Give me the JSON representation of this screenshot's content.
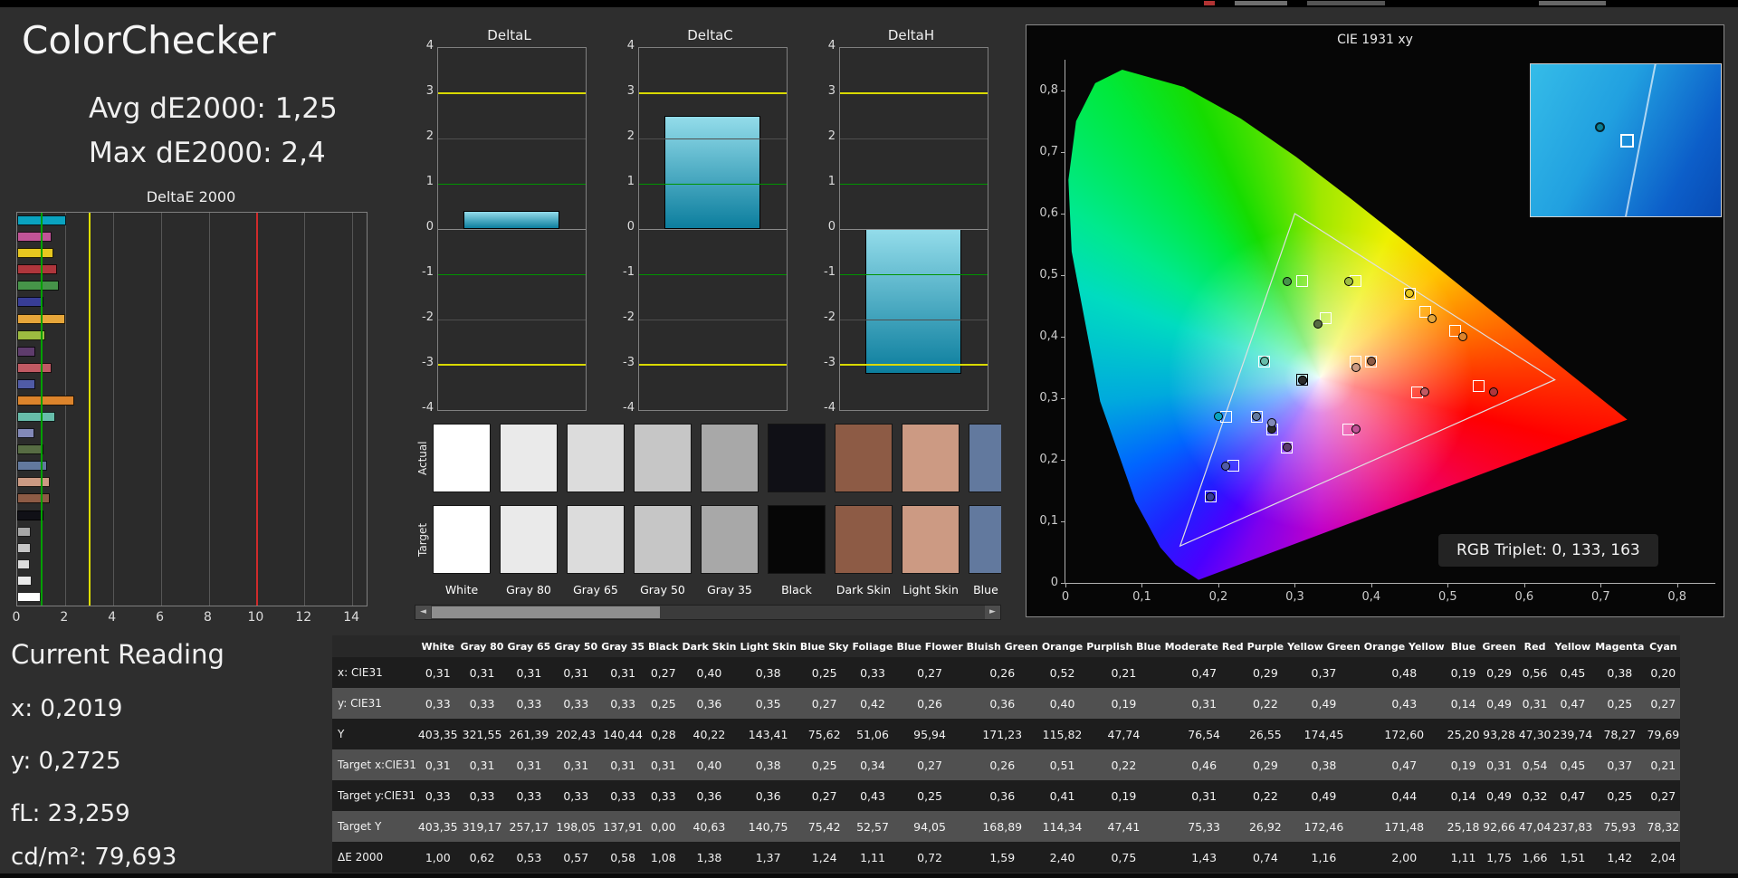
{
  "header": {
    "title": "ColorChecker",
    "avg": "Avg dE2000: 1,25",
    "max": "Max dE2000: 2,4"
  },
  "current_reading": {
    "title": "Current Reading",
    "lines": [
      "x: 0,2019",
      "y: 0,2725",
      "fL: 23,259",
      "cd/m²: 79,693"
    ]
  },
  "deltae_chart": {
    "title": "DeltaE 2000",
    "x_ticks": [
      0,
      2,
      4,
      6,
      8,
      10,
      12,
      14
    ],
    "x_max": 14.6,
    "thresholds": {
      "green": 1,
      "yellow": 3,
      "red": 10
    }
  },
  "delta_bars": {
    "y_ticks": [
      "4",
      "3",
      "2",
      "1",
      "0",
      "-1",
      "-2",
      "-3",
      "-4"
    ],
    "charts": [
      {
        "title": "DeltaL",
        "value": 0.4
      },
      {
        "title": "DeltaC",
        "value": 2.5
      },
      {
        "title": "DeltaH",
        "value": -3.2
      }
    ]
  },
  "swatch_panel": {
    "row_labels": [
      "Actual",
      "Target"
    ],
    "visible_count": 9,
    "scrollbar": {
      "left_arrow": "◄",
      "right_arrow": "►"
    }
  },
  "cie": {
    "title": "CIE 1931 xy",
    "rgb_label": "RGB Triplet: 0, 133, 163",
    "tick_labels": [
      "0",
      "0,1",
      "0,2",
      "0,3",
      "0,4",
      "0,5",
      "0,6",
      "0,7",
      "0,8"
    ],
    "axis_max": 0.85,
    "srgb_triangle": [
      [
        0.64,
        0.33
      ],
      [
        0.3,
        0.6
      ],
      [
        0.15,
        0.06
      ]
    ],
    "locus": [
      [
        0.1741,
        0.005
      ],
      [
        0.144,
        0.0297
      ],
      [
        0.1241,
        0.0578
      ],
      [
        0.0913,
        0.1327
      ],
      [
        0.0454,
        0.295
      ],
      [
        0.0082,
        0.5384
      ],
      [
        0.0039,
        0.6548
      ],
      [
        0.0139,
        0.7502
      ],
      [
        0.0389,
        0.812
      ],
      [
        0.0743,
        0.8338
      ],
      [
        0.1547,
        0.8059
      ],
      [
        0.2296,
        0.7543
      ],
      [
        0.3016,
        0.6923
      ],
      [
        0.3731,
        0.6245
      ],
      [
        0.4441,
        0.5547
      ],
      [
        0.5125,
        0.4866
      ],
      [
        0.5752,
        0.4242
      ],
      [
        0.627,
        0.3725
      ],
      [
        0.6915,
        0.3083
      ],
      [
        0.7347,
        0.2653
      ]
    ]
  },
  "table": {
    "corner": "",
    "columns": [
      "White",
      "Gray 80",
      "Gray 65",
      "Gray 50",
      "Gray 35",
      "Black",
      "Dark Skin",
      "Light Skin",
      "Blue Sky",
      "Foliage",
      "Blue Flower",
      "Bluish Green",
      "Orange",
      "Purplish Blue",
      "Moderate Red",
      "Purple",
      "Yellow Green",
      "Orange Yellow",
      "Blue",
      "Green",
      "Red",
      "Yellow",
      "Magenta",
      "Cyan"
    ],
    "rows": [
      {
        "label": "x: CIE31",
        "key": "x"
      },
      {
        "label": "y: CIE31",
        "key": "y"
      },
      {
        "label": "Y",
        "key": "Y"
      },
      {
        "label": "Target x:CIE31",
        "key": "tx"
      },
      {
        "label": "Target y:CIE31",
        "key": "ty"
      },
      {
        "label": "Target Y",
        "key": "tY"
      },
      {
        "label": "ΔE 2000",
        "key": "dE"
      }
    ]
  },
  "patches": [
    {
      "name": "White",
      "color": "#ffffff",
      "neutral": true,
      "x": "0,31",
      "y": "0,33",
      "Y": "403,35",
      "tx": "0,31",
      "ty": "0,33",
      "tY": "403,35",
      "dE": "1,00"
    },
    {
      "name": "Gray 80",
      "color": "#eaeaea",
      "neutral": true,
      "x": "0,31",
      "y": "0,33",
      "Y": "321,55",
      "tx": "0,31",
      "ty": "0,33",
      "tY": "319,17",
      "dE": "0,62"
    },
    {
      "name": "Gray 65",
      "color": "#dcdcdc",
      "neutral": true,
      "x": "0,31",
      "y": "0,33",
      "Y": "261,39",
      "tx": "0,31",
      "ty": "0,33",
      "tY": "257,17",
      "dE": "0,53"
    },
    {
      "name": "Gray 50",
      "color": "#c6c6c6",
      "neutral": true,
      "x": "0,31",
      "y": "0,33",
      "Y": "202,43",
      "tx": "0,31",
      "ty": "0,33",
      "tY": "198,05",
      "dE": "0,57"
    },
    {
      "name": "Gray 35",
      "color": "#a8a8a8",
      "neutral": true,
      "x": "0,31",
      "y": "0,33",
      "Y": "140,44",
      "tx": "0,31",
      "ty": "0,33",
      "tY": "137,91",
      "dE": "0,58"
    },
    {
      "name": "Black",
      "color": "#101016",
      "tcolor": "#060606",
      "neutral": true,
      "x": "0,27",
      "y": "0,25",
      "Y": "0,28",
      "tx": "0,31",
      "ty": "0,33",
      "tY": "0,00",
      "dE": "1,08"
    },
    {
      "name": "Dark Skin",
      "color": "#8d5b45",
      "x": "0,40",
      "y": "0,36",
      "Y": "40,22",
      "tx": "0,40",
      "ty": "0,36",
      "tY": "40,63",
      "dE": "1,38"
    },
    {
      "name": "Light Skin",
      "color": "#cc9a83",
      "x": "0,38",
      "y": "0,35",
      "Y": "143,41",
      "tx": "0,38",
      "ty": "0,36",
      "tY": "140,75",
      "dE": "1,37"
    },
    {
      "name": "Blue Sky",
      "color": "#62799e",
      "x": "0,25",
      "y": "0,27",
      "Y": "75,62",
      "tx": "0,25",
      "ty": "0,27",
      "tY": "75,42",
      "dE": "1,24"
    },
    {
      "name": "Foliage",
      "color": "#576c43",
      "x": "0,33",
      "y": "0,42",
      "Y": "51,06",
      "tx": "0,34",
      "ty": "0,43",
      "tY": "52,57",
      "dE": "1,11"
    },
    {
      "name": "Blue Flower",
      "color": "#8289b8",
      "x": "0,27",
      "y": "0,26",
      "Y": "95,94",
      "tx": "0,27",
      "ty": "0,25",
      "tY": "94,05",
      "dE": "0,72"
    },
    {
      "name": "Bluish Green",
      "color": "#67bdaa",
      "x": "0,26",
      "y": "0,36",
      "Y": "171,23",
      "tx": "0,26",
      "ty": "0,36",
      "tY": "168,89",
      "dE": "1,59"
    },
    {
      "name": "Orange",
      "color": "#dc842c",
      "x": "0,52",
      "y": "0,40",
      "Y": "115,82",
      "tx": "0,51",
      "ty": "0,41",
      "tY": "114,34",
      "dE": "2,40"
    },
    {
      "name": "Purplish Blue",
      "color": "#505ba6",
      "x": "0,21",
      "y": "0,19",
      "Y": "47,74",
      "tx": "0,22",
      "ty": "0,19",
      "tY": "47,41",
      "dE": "0,75"
    },
    {
      "name": "Moderate Red",
      "color": "#c15a63",
      "x": "0,47",
      "y": "0,31",
      "Y": "76,54",
      "tx": "0,46",
      "ty": "0,31",
      "tY": "75,33",
      "dE": "1,43"
    },
    {
      "name": "Purple",
      "color": "#5e3c6c",
      "x": "0,29",
      "y": "0,22",
      "Y": "26,55",
      "tx": "0,29",
      "ty": "0,22",
      "tY": "26,92",
      "dE": "0,74"
    },
    {
      "name": "Yellow Green",
      "color": "#9dbc40",
      "x": "0,37",
      "y": "0,49",
      "Y": "174,45",
      "tx": "0,38",
      "ty": "0,49",
      "tY": "172,46",
      "dE": "1,16"
    },
    {
      "name": "Orange Yellow",
      "color": "#e7a63a",
      "x": "0,48",
      "y": "0,43",
      "Y": "172,60",
      "tx": "0,47",
      "ty": "0,44",
      "tY": "171,48",
      "dE": "2,00"
    },
    {
      "name": "Blue",
      "color": "#383d96",
      "x": "0,19",
      "y": "0,14",
      "Y": "25,20",
      "tx": "0,19",
      "ty": "0,14",
      "tY": "25,18",
      "dE": "1,11"
    },
    {
      "name": "Green",
      "color": "#469449",
      "x": "0,29",
      "y": "0,49",
      "Y": "93,28",
      "tx": "0,31",
      "ty": "0,49",
      "tY": "92,66",
      "dE": "1,75"
    },
    {
      "name": "Red",
      "color": "#af363c",
      "x": "0,56",
      "y": "0,31",
      "Y": "47,30",
      "tx": "0,54",
      "ty": "0,32",
      "tY": "47,04",
      "dE": "1,66"
    },
    {
      "name": "Yellow",
      "color": "#e7c71f",
      "x": "0,45",
      "y": "0,47",
      "Y": "239,74",
      "tx": "0,45",
      "ty": "0,47",
      "tY": "237,83",
      "dE": "1,51"
    },
    {
      "name": "Magenta",
      "color": "#c15497",
      "x": "0,38",
      "y": "0,25",
      "Y": "78,27",
      "tx": "0,37",
      "ty": "0,25",
      "tY": "75,93",
      "dE": "1,42"
    },
    {
      "name": "Cyan",
      "color": "#0aa3c0",
      "x": "0,20",
      "y": "0,27",
      "Y": "79,69",
      "tx": "0,21",
      "ty": "0,27",
      "tY": "78,32",
      "dE": "2,04"
    }
  ]
}
